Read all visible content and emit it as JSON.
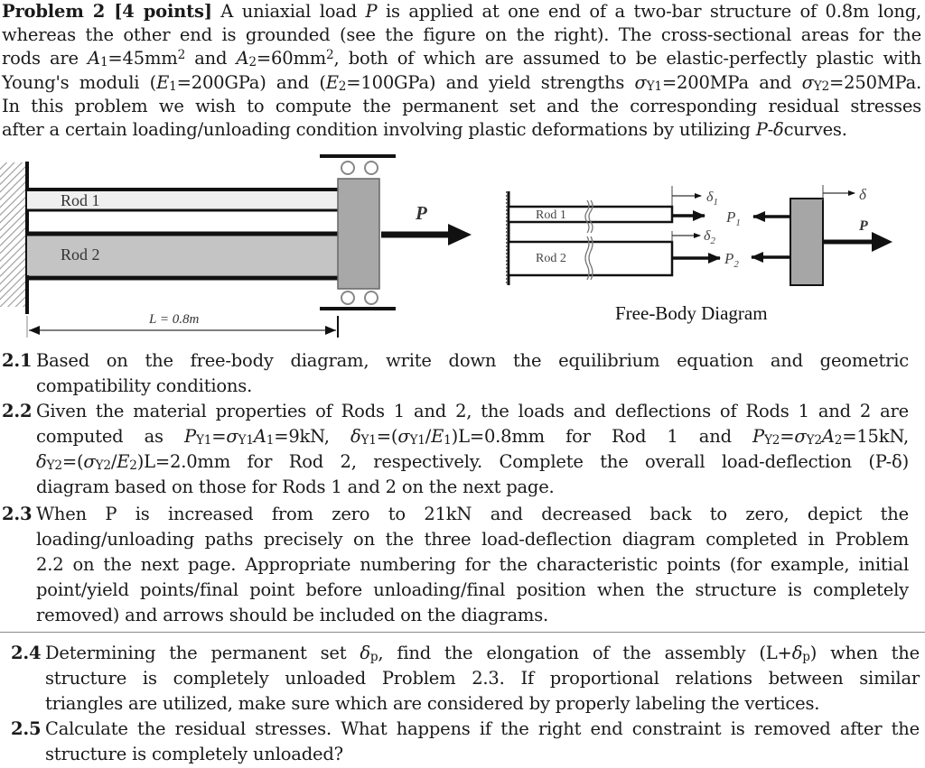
{
  "problem": {
    "heading": "Problem 2 [4 points]",
    "intro_lines": [
      " A uniaxial load P is applied at one end of a two-bar structure of 0.8m long,",
      "whereas the other end is grounded (see the figure on the right). The cross-sectional areas for the",
      "rods are A1=45mm2 and A2=60mm2, both of which are assumed to be elastic-perfectly plastic with",
      "Young's moduli (E1=200GPa) and (E2=100GPa) and yield strengths σY1=200MPa and σY2=250MPa.",
      "In this problem we wish to compute the permanent set and the corresponding residual stresses",
      "after a certain loading/unloading condition involving plastic deformations by utilizing P-δ curves."
    ],
    "values": {
      "length": "0.8m",
      "A1": "45mm2",
      "A2": "60mm2",
      "E1": "200GPa",
      "E2": "100GPa",
      "sigma_Y1": "200MPa",
      "sigma_Y2": "250MPa"
    }
  },
  "figure_left": {
    "rod1_label": "Rod 1",
    "rod2_label": "Rod 2",
    "load_label": "P",
    "length_label": "L = 0.8m"
  },
  "figure_right": {
    "rod1_label": "Rod 1",
    "rod2_label": "Rod 2",
    "delta1_label": "δ1",
    "delta2_label": "δ2",
    "delta_label": "δ",
    "p1_label": "P1",
    "p2_label": "P2",
    "p_label": "P",
    "caption": "Free-Body Diagram"
  },
  "questions": [
    {
      "number": "2.1",
      "lines": [
        "Based on the free-body diagram, write down the equilibrium equation and geometric",
        "compatibility conditions."
      ]
    },
    {
      "number": "2.2",
      "lines": [
        "Given the material properties of Rods 1 and 2, the loads and deflections of Rods 1 and 2 are",
        "computed as PY1=σY1A1=9kN, δY1=(σY1/E1)L=0.8mm for Rod 1 and PY2=σY2A2=15kN,",
        "δY2=(σY2/E2)L=2.0mm for Rod 2, respectively. Complete the overall load-deflection (P-δ)",
        "diagram based on those for Rods 1 and 2 on the next page."
      ],
      "values": {
        "PY1": "9kN",
        "deltaY1": "0.8mm",
        "PY2": "15kN",
        "deltaY2": "2.0mm"
      }
    },
    {
      "number": "2.3",
      "lines": [
        "When P is increased from zero to 21kN and decreased back to zero, depict the",
        "loading/unloading paths precisely on the three load-deflection diagram completed in Problem",
        "2.2 on the next page. Appropriate numbering for the characteristic points (for example, initial",
        "point/yield points/final point before unloading/final position when the structure is completely",
        "removed) and arrows should be included on the diagrams."
      ],
      "values": {
        "P_max": "21kN"
      }
    },
    {
      "number": "2.4",
      "lines": [
        "Determining the permanent set δp, find the elongation of the assembly (L+δp) when the",
        "structure is completely unloaded Problem 2.3. If proportional relations between similar",
        "triangles are utilized, make sure which are considered by properly labeling the vertices."
      ]
    },
    {
      "number": "2.5",
      "lines": [
        "Calculate the residual stresses. What happens if the right end constraint is removed after the",
        "structure is completely unloaded?"
      ]
    }
  ]
}
